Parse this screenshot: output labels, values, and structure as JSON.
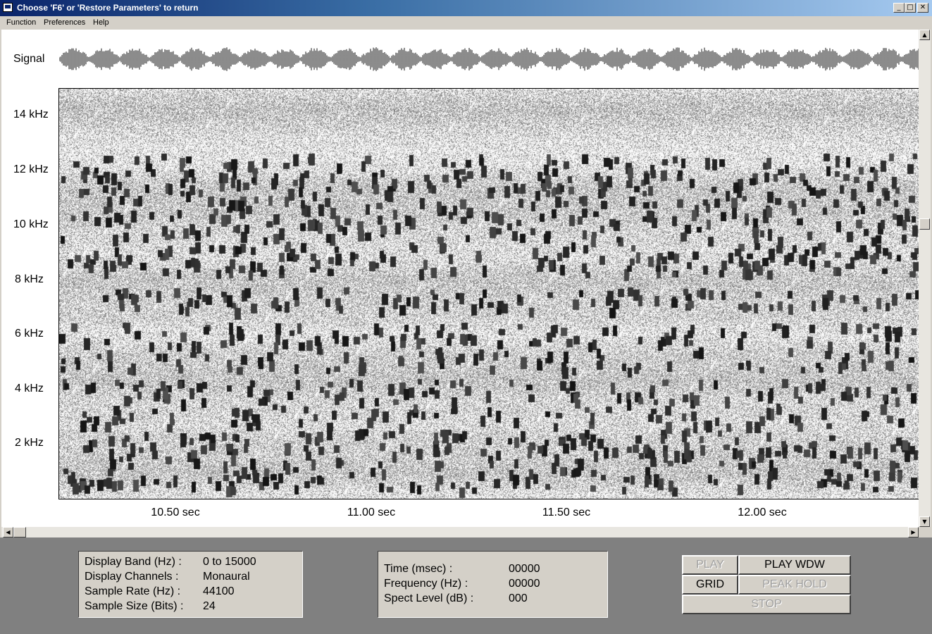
{
  "window": {
    "title": "Choose 'F6' or 'Restore Parameters' to return",
    "minimize": "_",
    "maximize": "□",
    "close": "✕"
  },
  "menu": {
    "items": [
      "Function",
      "Preferences",
      "Help"
    ]
  },
  "display": {
    "signal_label": "Signal",
    "y_ticks": [
      "14 kHz",
      "12 kHz",
      "10 kHz",
      "8 kHz",
      "6 kHz",
      "4 kHz",
      "2 kHz"
    ],
    "x_ticks": [
      "10.50 sec",
      "11.00 sec",
      "11.50 sec",
      "12.00 sec"
    ]
  },
  "chart_data": {
    "type": "heatmap",
    "title": "",
    "xlabel": "",
    "ylabel": "",
    "y_ticks": [
      "14 kHz",
      "12 kHz",
      "10 kHz",
      "8 kHz",
      "6 kHz",
      "4 kHz",
      "2 kHz"
    ],
    "x_ticks": [
      "10.50 sec",
      "11.00 sec",
      "11.50 sec",
      "12.00 sec"
    ],
    "colormap": "grayscale"
  },
  "info": {
    "rows": [
      {
        "label": "Display Band (Hz) :",
        "value": "0 to 15000"
      },
      {
        "label": "Display Channels :",
        "value": "Monaural"
      },
      {
        "label": "Sample Rate (Hz) :",
        "value": "44100"
      },
      {
        "label": "Sample Size (Bits) :",
        "value": "24"
      }
    ]
  },
  "readout": {
    "rows": [
      {
        "label": "Time (msec) :",
        "value": "00000"
      },
      {
        "label": "Frequency (Hz) :",
        "value": "00000"
      },
      {
        "label": "Spect Level (dB) :",
        "value": "000"
      }
    ]
  },
  "buttons": {
    "play": "PLAY",
    "play_wdw": "PLAY WDW",
    "grid": "GRID",
    "peak_hold": "PEAK HOLD",
    "stop": "STOP"
  },
  "icons": {
    "app": "terminal-icon",
    "scroll_up": "arrow-up-icon",
    "scroll_down": "arrow-down-icon",
    "scroll_left": "arrow-left-icon",
    "scroll_right": "arrow-right-icon"
  }
}
